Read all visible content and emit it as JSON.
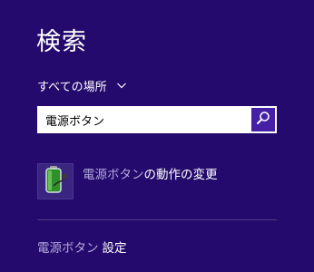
{
  "search_pane": {
    "title": "検索",
    "scope": {
      "label": "すべての場所",
      "icon": "chevron-down-icon"
    },
    "search": {
      "value": "電源ボタン",
      "button_icon": "magnifier-icon"
    },
    "results": [
      {
        "icon": "battery-power-icon",
        "highlight": "電源ボタン",
        "rest": "の動作の変更"
      }
    ],
    "footer": {
      "highlight": "電源ボタン",
      "rest": "設定"
    }
  },
  "colors": {
    "background": "#240a6c",
    "search_button": "#4520a6",
    "highlight_text": "#b3a9de",
    "divider": "#52407f"
  }
}
